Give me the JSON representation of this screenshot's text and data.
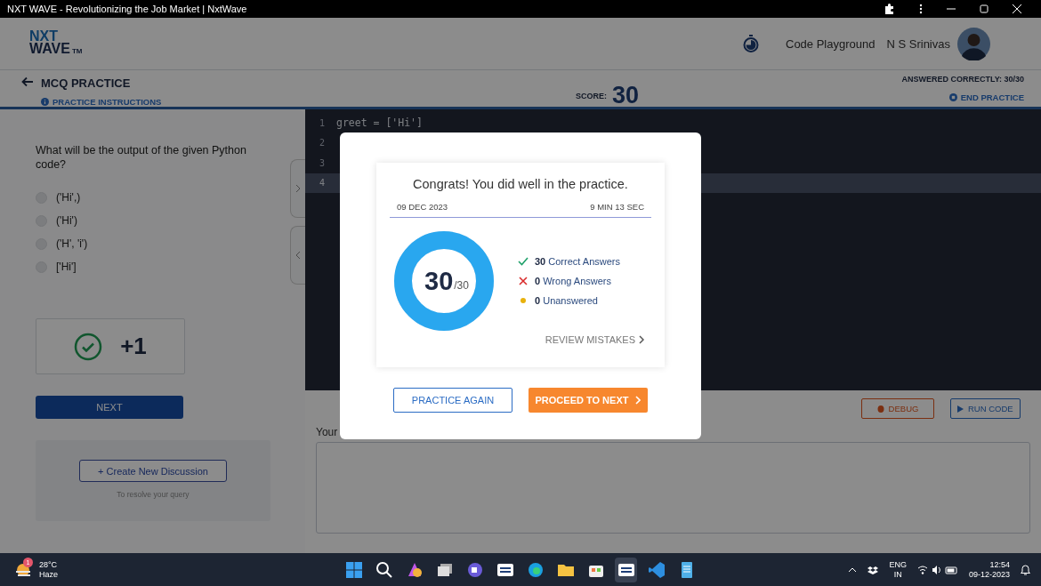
{
  "window": {
    "title": "NXT WAVE - Revolutionizing the Job Market | NxtWave"
  },
  "header": {
    "logo_top": "NXT",
    "logo_bottom": "WAVE",
    "logo_mark": "TM",
    "link": "Code Playground",
    "user": "N S Srinivas"
  },
  "practice_bar": {
    "title": "MCQ PRACTICE",
    "instructions": "PRACTICE INSTRUCTIONS",
    "score_label": "SCORE:",
    "score": "30",
    "answered": "ANSWERED CORRECTLY: 30/30",
    "end": "END PRACTICE"
  },
  "question": {
    "text": "What will be the output of the given Python code?",
    "options": [
      {
        "label": "('Hi',)",
        "selected": false
      },
      {
        "label": "('Hi')",
        "selected": false
      },
      {
        "label": "('H', 'i')",
        "selected": false
      },
      {
        "label": "['Hi']",
        "selected": false
      }
    ]
  },
  "result": {
    "correct": true,
    "points": "+1"
  },
  "next_button": "NEXT",
  "discussion": {
    "button": "+ Create New Discussion",
    "hint": "To resolve your query"
  },
  "editor": {
    "lines": [
      {
        "number": "1",
        "code": "greet = ['Hi']",
        "selected": false
      },
      {
        "number": "2",
        "selected": false
      },
      {
        "number": "3",
        "selected": false
      },
      {
        "number": "4",
        "selected": true
      }
    ]
  },
  "actions": [
    {
      "kind": "debug",
      "label": "DEBUG"
    },
    {
      "kind": "run",
      "label": "RUN CODE"
    }
  ],
  "input": {
    "label": "Your"
  },
  "modal": {
    "title": "Congrats! You did well in the practice.",
    "date": "09 DEC 2023",
    "duration": "9 MIN 13 SEC",
    "score": "30",
    "total": "/30",
    "level": 1,
    "stats": [
      {
        "kind": "correct",
        "count": "30",
        "label": "Correct Answers"
      },
      {
        "kind": "wrong",
        "count": "0",
        "label": "Wrong Answers"
      },
      {
        "kind": "unanswered",
        "count": "0",
        "label": "Unanswered"
      }
    ],
    "review": "REVIEW MISTAKES",
    "buttons": [
      {
        "kind": "secondary",
        "label": "PRACTICE AGAIN"
      },
      {
        "kind": "primary",
        "label": "PROCEED TO NEXT"
      }
    ]
  },
  "taskbar": {
    "weather": {
      "temp": "28°C",
      "condition": "Haze",
      "badge": "1"
    },
    "apps": [
      {
        "kind": "start",
        "selected": false
      },
      {
        "kind": "search",
        "selected": false
      },
      {
        "kind": "paint",
        "selected": false
      },
      {
        "kind": "window",
        "selected": false
      },
      {
        "kind": "chat",
        "selected": false
      },
      {
        "kind": "web",
        "selected": false
      },
      {
        "kind": "browser",
        "selected": false
      },
      {
        "kind": "folder",
        "selected": false
      },
      {
        "kind": "store",
        "selected": false
      },
      {
        "kind": "web",
        "selected": true
      },
      {
        "kind": "code",
        "selected": false
      },
      {
        "kind": "notepad",
        "selected": false
      }
    ],
    "lang": "ENG",
    "region": "IN",
    "time": "12:54",
    "date": "09-12-2023"
  }
}
